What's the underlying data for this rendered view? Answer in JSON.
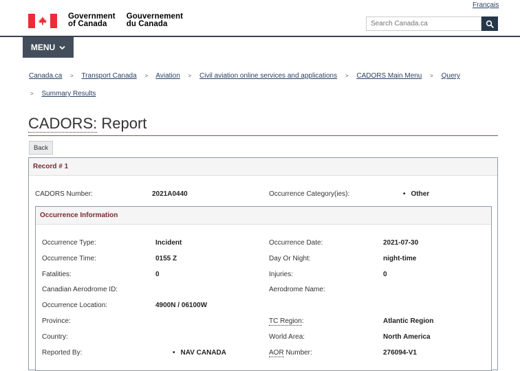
{
  "header": {
    "language_link": "Français",
    "wordmark_en_1": "Government",
    "wordmark_en_2": "of Canada",
    "wordmark_fr_1": "Gouvernement",
    "wordmark_fr_2": "du Canada",
    "search_placeholder": "Search Canada.ca",
    "menu_label": "MENU",
    "colors": {
      "flag_red": "#eb2d37",
      "menu_bg": "#444e5b",
      "search_btn_bg": "#26374a"
    }
  },
  "breadcrumb": [
    "Canada.ca",
    "Transport Canada",
    "Aviation",
    "Civil aviation online services and applications",
    "CADORS Main Menu",
    "Query",
    "Summary Results"
  ],
  "page": {
    "title_abbr": "CADORS:",
    "title_rest": " Report",
    "back_label": "Back"
  },
  "record": {
    "heading": "Record # 1",
    "cadors_number_label": "CADORS Number:",
    "cadors_number": "2021A0440",
    "category_label": "Occurrence Category(ies):",
    "category": "Other"
  },
  "occurrence": {
    "heading": "Occurrence Information",
    "fields": {
      "type_label": "Occurrence Type:",
      "type": "Incident",
      "date_label": "Occurrence Date:",
      "date": "2021-07-30",
      "time_label": "Occurrence Time:",
      "time": "0155 Z",
      "daynight_label": "Day Or Night:",
      "daynight": "night-time",
      "fatalities_label": "Fatalities:",
      "fatalities": "0",
      "injuries_label": "Injuries:",
      "injuries": "0",
      "aerodrome_id_label": "Canadian Aerodrome ID:",
      "aerodrome_name_label": "Aerodrome Name:",
      "location_label": "Occurrence Location:",
      "location": "4900N / 06100W",
      "province_label": "Province:",
      "tc_region_label_abbr": "TC Region",
      "tc_region_label_suffix": ":",
      "tc_region": "Atlantic Region",
      "country_label": "Country:",
      "world_area_label": "World Area:",
      "world_area": "North America",
      "reported_by_label": "Reported By:",
      "reported_by": "NAV CANADA",
      "aor_label_abbr": "AOR",
      "aor_label_suffix": " Number:",
      "aor_number": "276094-V1"
    }
  }
}
